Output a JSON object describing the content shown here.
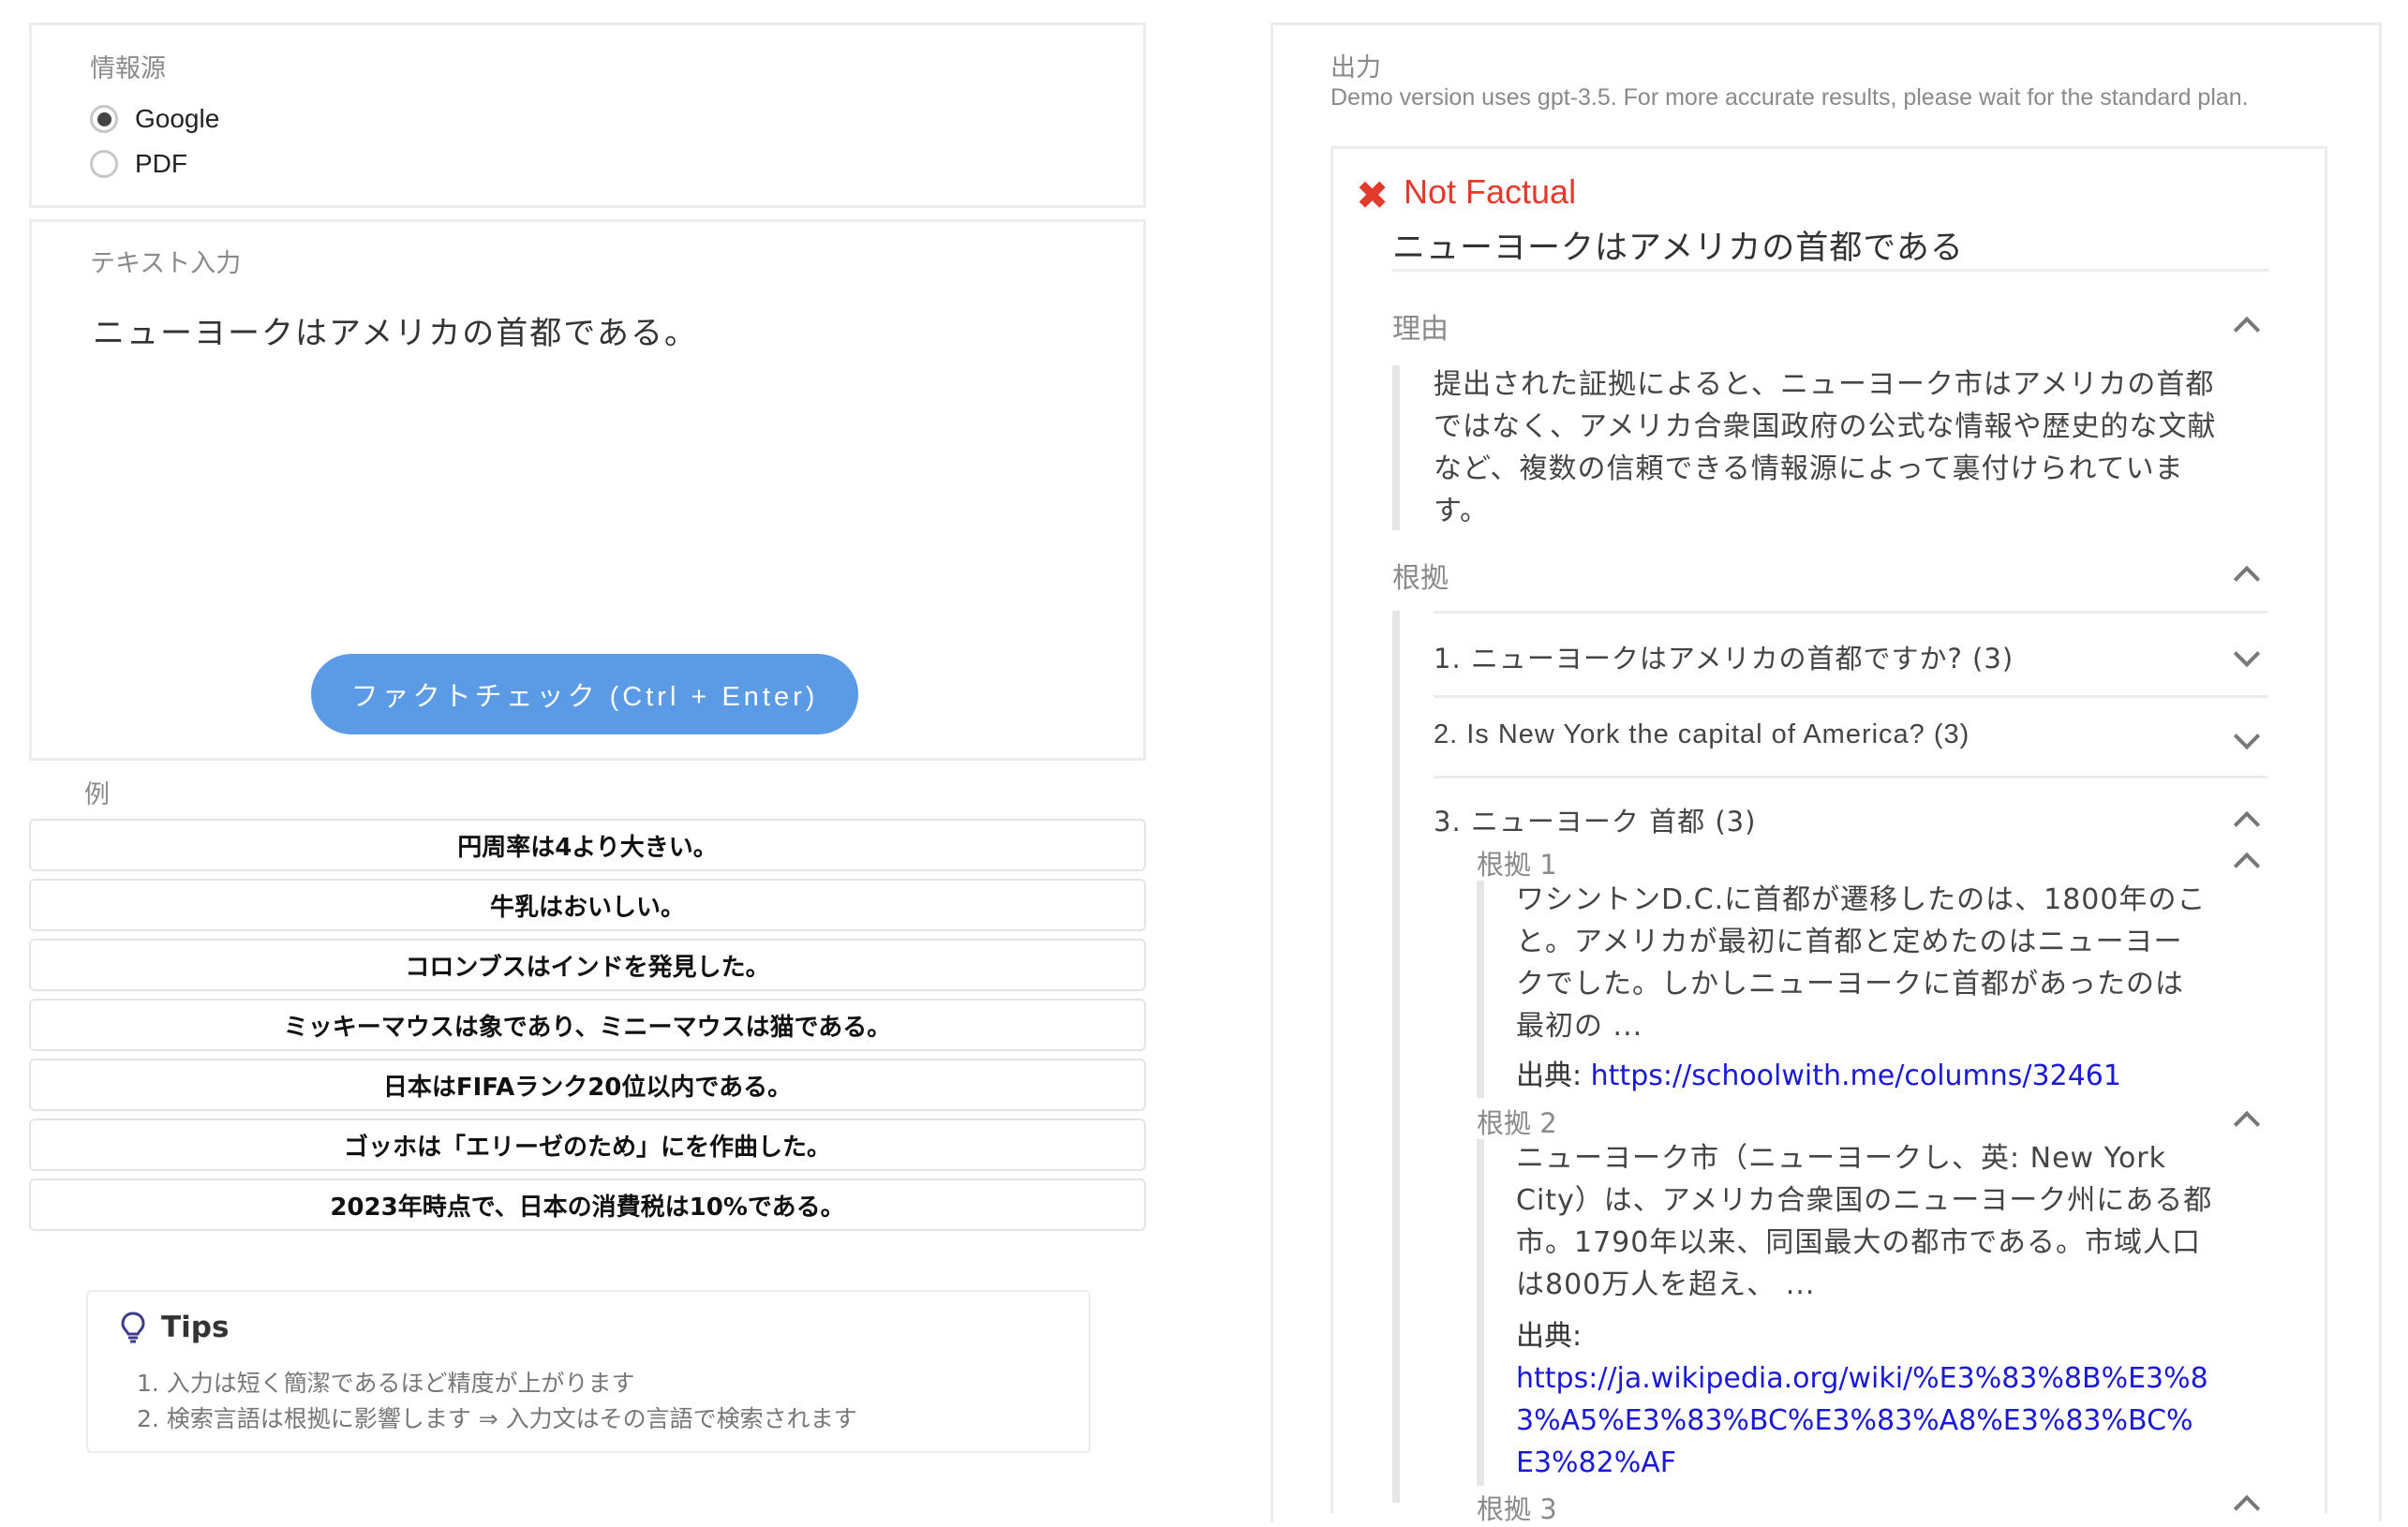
{
  "input_panel": {
    "source_label": "情報源",
    "options": [
      {
        "label": "Google",
        "checked": true
      },
      {
        "label": "PDF",
        "checked": false
      }
    ],
    "text_input_label": "テキスト入力",
    "text_value": "ニューヨークはアメリカの首都である。",
    "submit_label": "ファクトチェック (Ctrl + Enter)"
  },
  "examples": {
    "label": "例",
    "items": [
      "円周率は4より大きい。",
      "牛乳はおいしい。",
      "コロンブスはインドを発見した。",
      "ミッキーマウスは象であり、ミニーマウスは猫である。",
      "日本はFIFAランク20位以内である。",
      "ゴッホは「エリーゼのため」にを作曲した。",
      "2023年時点で、日本の消費税は10%である。"
    ]
  },
  "tips": {
    "title": "Tips",
    "lines": [
      "1. 入力は短く簡潔であるほど精度が上がります",
      "2. 検索言語は根拠に影響します ⇒ 入力文はその言語で検索されます"
    ]
  },
  "output": {
    "label": "出力",
    "note": "Demo version uses gpt-3.5. For more accurate results, please wait for the standard plan.",
    "verdict": "Not Factual",
    "claim": "ニューヨークはアメリカの首都である",
    "reason_title": "理由",
    "reason_text": "提出された証拠によると、ニューヨーク市はアメリカの首都ではなく、アメリカ合衆国政府の公式な情報や歴史的な文献など、複数の信頼できる情報源によって裏付けられています。",
    "evidence_title": "根拠",
    "queries": [
      "1. ニューヨークはアメリカの首都ですか? (3)",
      "2. Is New York the capital of America? (3)",
      "3. ニューヨーク 首都 (3)"
    ],
    "evidence": [
      {
        "label": "根拠 1",
        "text": "ワシントンD.C.に首都が遷移したのは、1800年のこと。アメリカが最初に首都と定めたのはニューヨークでした。しかしニューヨークに首都があったのは最初の ...",
        "source_prefix": "出典:",
        "url": "https://schoolwith.me/columns/32461"
      },
      {
        "label": "根拠 2",
        "text": "ニューヨーク市（ニューヨークし、英: New York City）は、アメリカ合衆国のニューヨーク州にある都市。1790年以来、同国最大の都市である。市域人口は800万人を超え、 ...",
        "source_prefix": "出典:",
        "url": "https://ja.wikipedia.org/wiki/%E3%83%8B%E3%83%A5%E3%83%BC%E3%83%A8%E3%83%BC%E3%82%AF"
      },
      {
        "label": "根拠 3"
      }
    ]
  },
  "colors": {
    "accent": "#5b9be6",
    "error": "#e23b2b",
    "link": "#1a1ad6"
  }
}
